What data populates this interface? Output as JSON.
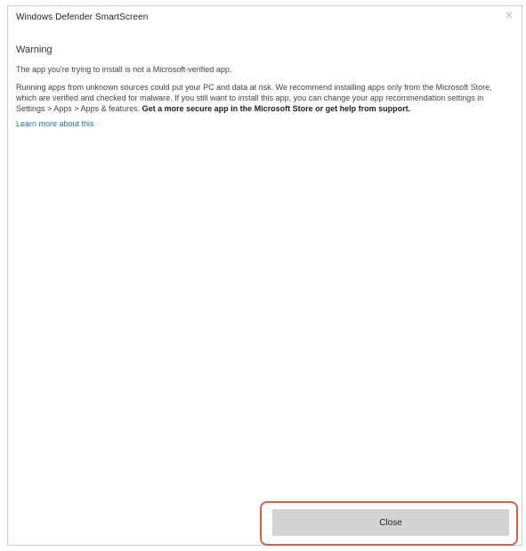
{
  "window": {
    "title": "Windows Defender SmartScreen",
    "close_glyph": "✕"
  },
  "content": {
    "heading": "Warning",
    "intro": "The app you're trying to install is not a Microsoft-verified app.",
    "body_line1": "Running apps from unknown sources could put your PC and data at risk. We recommend installing apps only from the Microsoft Store, which are verified and",
    "body_line2": "checked for malware. If you still want to install this app, you can change your app recommendation settings in Settings > Apps > Apps & features.",
    "body_bold": "Get a more secure app in the Microsoft Store or get help from support.",
    "link_text": "Learn more about this"
  },
  "footer": {
    "close_label": "Close"
  }
}
